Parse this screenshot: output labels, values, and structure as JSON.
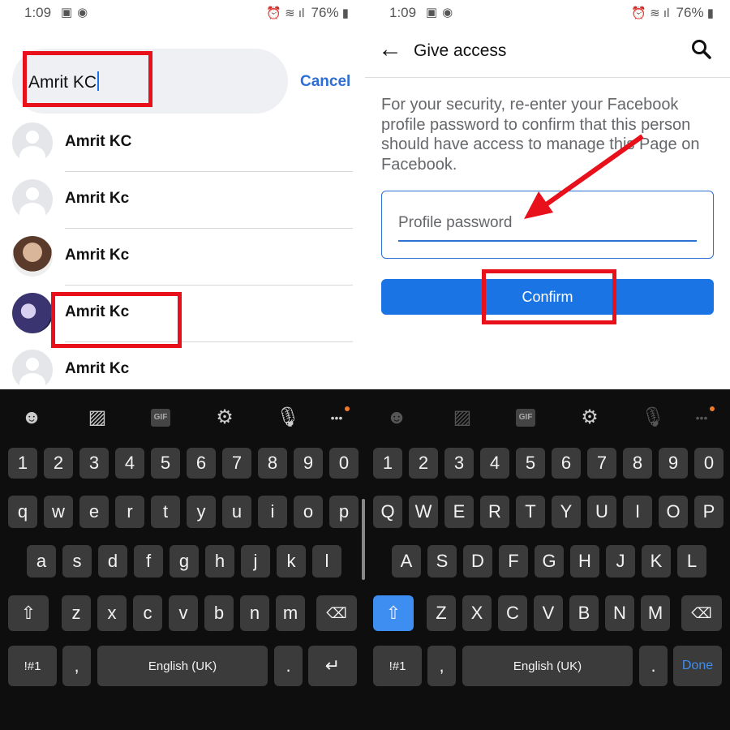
{
  "status": {
    "time": "1:09",
    "battery": "76%"
  },
  "left": {
    "search": {
      "value": "Amrit KC",
      "cancel": "Cancel"
    },
    "results": [
      {
        "name": "Amrit KC",
        "avatar": "default"
      },
      {
        "name": "Amrit Kc",
        "avatar": "default"
      },
      {
        "name": "Amrit Kc",
        "avatar": "photo"
      },
      {
        "name": "Amrit Kc",
        "avatar": "anime"
      },
      {
        "name": "Amrit Kc",
        "avatar": "default"
      }
    ]
  },
  "right": {
    "header": {
      "title": "Give access"
    },
    "message": "For your security, re-enter your Facebook profile password to confirm that this person should have access to manage this Page on Facebook.",
    "password": {
      "placeholder": "Profile password",
      "value": ""
    },
    "confirm": "Confirm"
  },
  "keyboard": {
    "toolbar": [
      "emoji-icon",
      "sticker-icon",
      "gif-icon",
      "gear-icon",
      "microphone-icon",
      "more-icon"
    ],
    "gif": "GIF",
    "numbers": [
      "1",
      "2",
      "3",
      "4",
      "5",
      "6",
      "7",
      "8",
      "9",
      "0"
    ],
    "lower": [
      [
        "q",
        "w",
        "e",
        "r",
        "t",
        "y",
        "u",
        "i",
        "o",
        "p"
      ],
      [
        "a",
        "s",
        "d",
        "f",
        "g",
        "h",
        "j",
        "k",
        "l"
      ],
      [
        "z",
        "x",
        "c",
        "v",
        "b",
        "n",
        "m"
      ]
    ],
    "upper": [
      [
        "Q",
        "W",
        "E",
        "R",
        "T",
        "Y",
        "U",
        "I",
        "O",
        "P"
      ],
      [
        "A",
        "S",
        "D",
        "F",
        "G",
        "H",
        "J",
        "K",
        "L"
      ],
      [
        "Z",
        "X",
        "C",
        "V",
        "B",
        "N",
        "M"
      ]
    ],
    "symbols": "!#1",
    "comma": ",",
    "space": "English (UK)",
    "period": ".",
    "done": "Done",
    "colors": {
      "shift_active": "#3d8ef0",
      "done": "#3d8ef0",
      "notification_dot": "#f07a2a"
    }
  },
  "colors": {
    "annotation": "#e8101a",
    "facebook_blue": "#1b74e4"
  }
}
